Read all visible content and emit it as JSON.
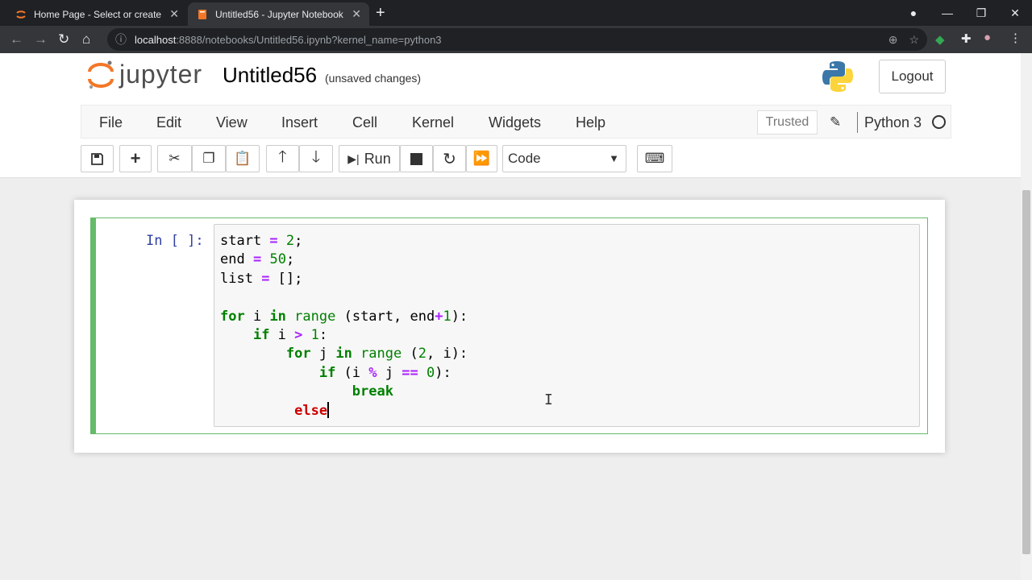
{
  "browser": {
    "tabs": [
      {
        "title": "Home Page - Select or create a n",
        "active": false
      },
      {
        "title": "Untitled56 - Jupyter Notebook",
        "active": true
      }
    ],
    "url_host": "localhost",
    "url_rest": ":8888/notebooks/Untitled56.ipynb?kernel_name=python3"
  },
  "header": {
    "logo_text": "jupyter",
    "notebook_name": "Untitled56",
    "save_status": "(unsaved changes)",
    "logout_label": "Logout"
  },
  "menubar": {
    "items": [
      "File",
      "Edit",
      "View",
      "Insert",
      "Cell",
      "Kernel",
      "Widgets",
      "Help"
    ],
    "trusted_label": "Trusted",
    "kernel_name": "Python 3"
  },
  "toolbar": {
    "run_label": "Run",
    "cell_type": "Code"
  },
  "cell": {
    "prompt": "In [ ]:",
    "code_lines": [
      "start = 2;",
      "end = 50;",
      "list = [];",
      "",
      "for i in range (start, end+1):",
      "    if i > 1:",
      "        for j in range (2, i):",
      "            if (i % j == 0):",
      "                break",
      "         else"
    ]
  },
  "colors": {
    "cell_border": "#66bb6a",
    "prompt": "#303f9f",
    "keyword": "#008000",
    "operator": "#aa22ff"
  }
}
